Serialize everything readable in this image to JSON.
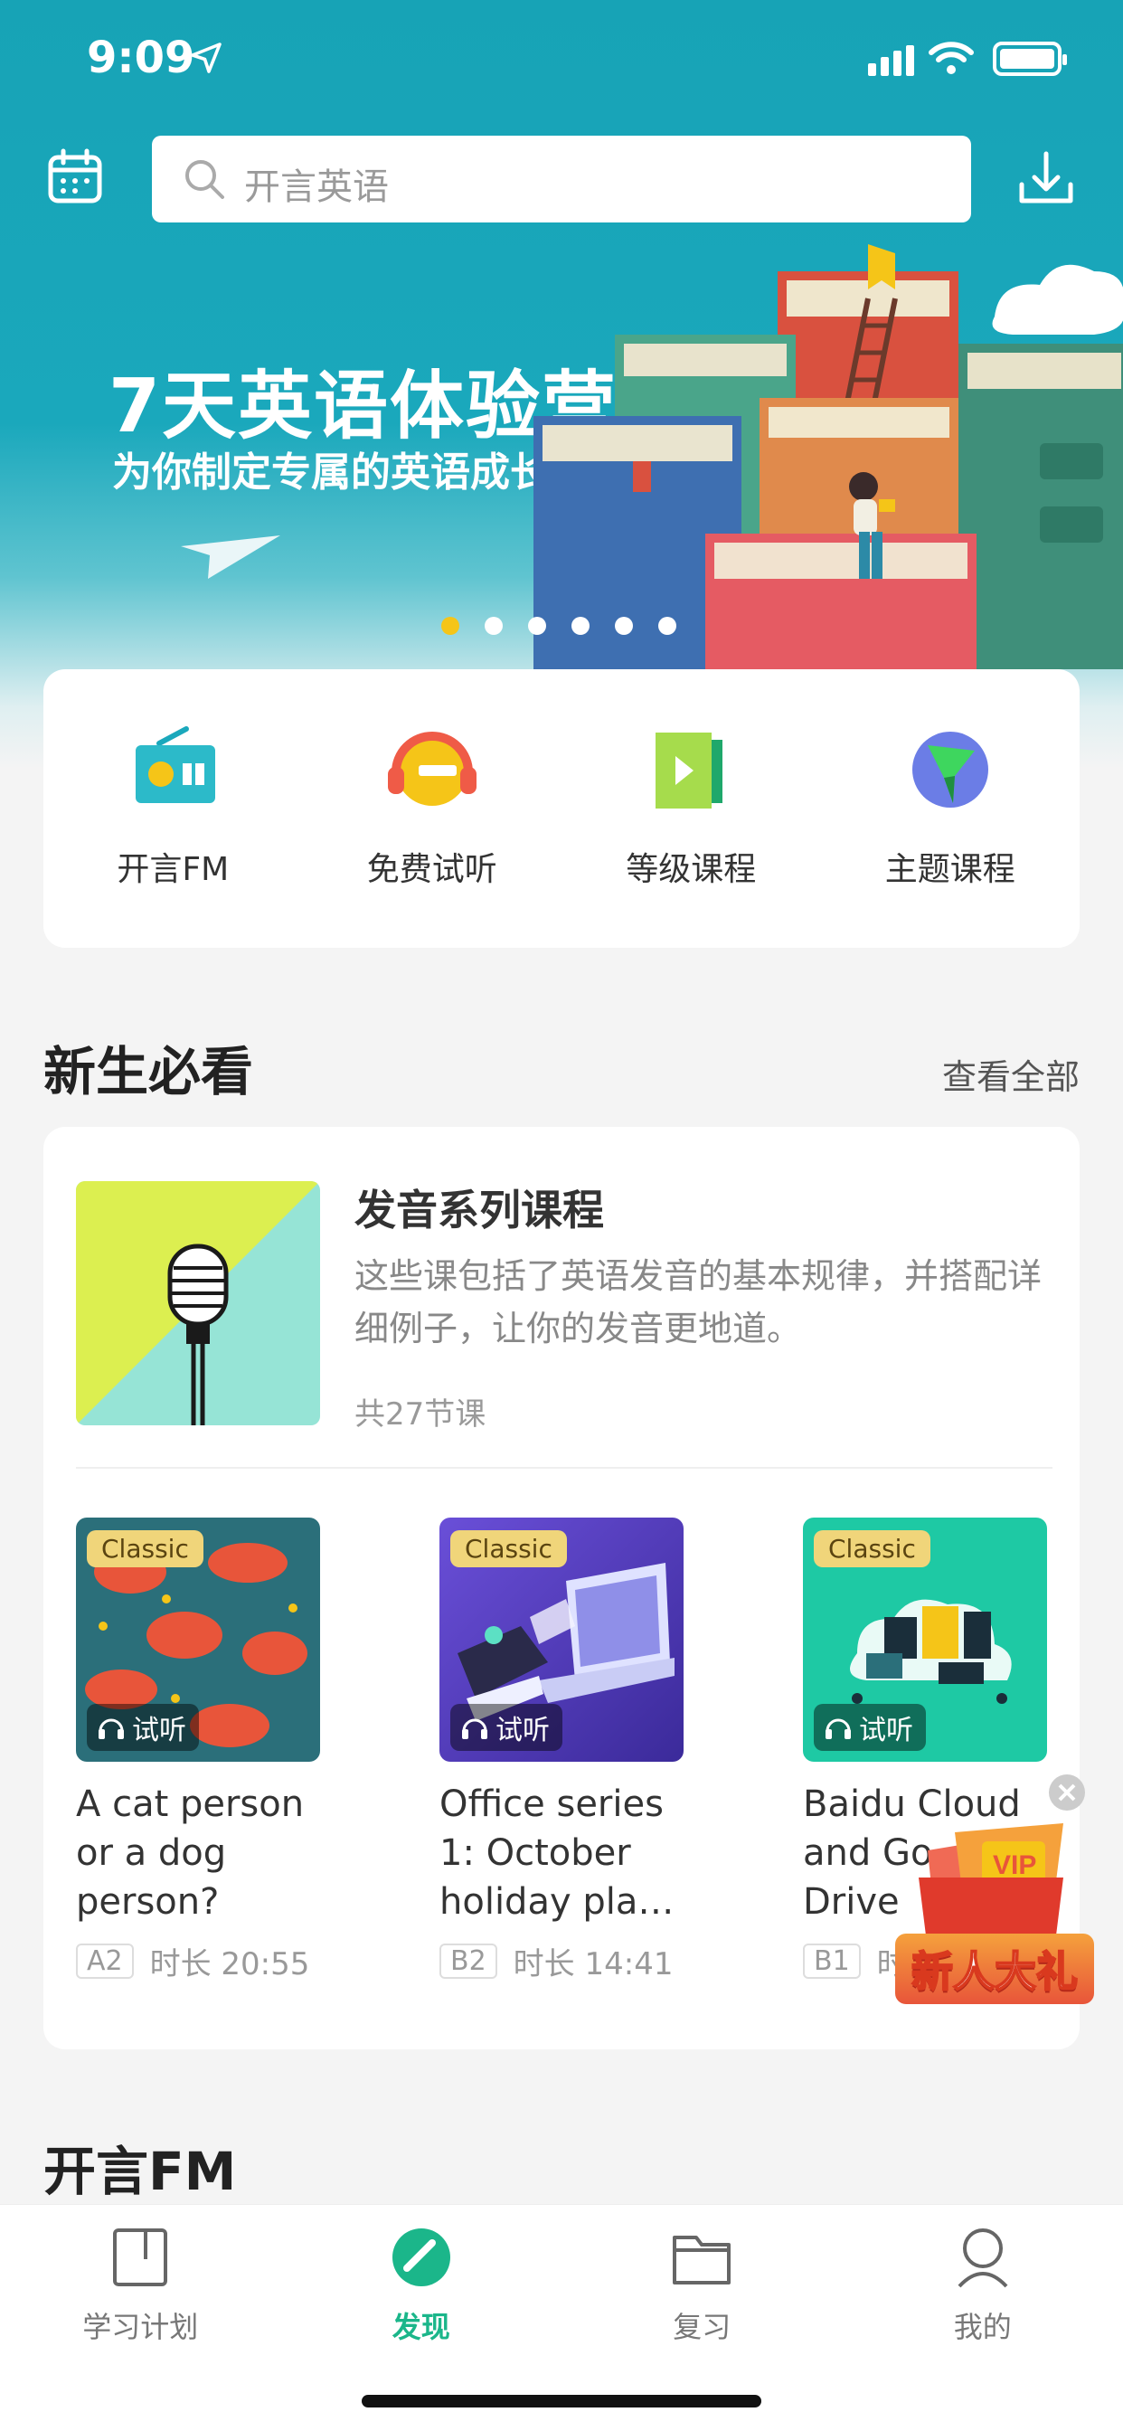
{
  "status": {
    "time": "9:09"
  },
  "search": {
    "placeholder": "开言英语"
  },
  "banner": {
    "title": "7天英语体验营",
    "subtitle": "为你制定专属的英语成长计划",
    "dots": 6,
    "active_dot": 0
  },
  "quick": [
    {
      "label": "开言FM",
      "icon": "radio-icon"
    },
    {
      "label": "免费试听",
      "icon": "headphones-icon"
    },
    {
      "label": "等级课程",
      "icon": "video-icon"
    },
    {
      "label": "主题课程",
      "icon": "globe-icon"
    }
  ],
  "section": {
    "title": "新生必看",
    "more": "查看全部"
  },
  "featured": {
    "title": "发音系列课程",
    "desc": "这些课包括了英语发音的基本规律，并搭配详细例子，让你的发音更地道。",
    "count": "共27节课"
  },
  "courses": [
    {
      "badge": "Classic",
      "trial": "试听",
      "title": "A cat person or a dog person?",
      "level": "A2",
      "duration": "时长 20:55"
    },
    {
      "badge": "Classic",
      "trial": "试听",
      "title": "Office series 1: October holiday pla…",
      "level": "B2",
      "duration": "时长 14:41"
    },
    {
      "badge": "Classic",
      "trial": "试听",
      "title": "Baidu Cloud and Go… Drive",
      "level": "B1",
      "duration": "时长"
    }
  ],
  "promo": {
    "label": "新人大礼",
    "vip": "VIP"
  },
  "fm_section": {
    "title": "开言FM"
  },
  "tabs": [
    {
      "label": "学习计划",
      "active": false
    },
    {
      "label": "发现",
      "active": true
    },
    {
      "label": "复习",
      "active": false
    },
    {
      "label": "我的",
      "active": false
    }
  ],
  "colors": {
    "brand": "#1aa8bc",
    "accent": "#1bb68a",
    "dot_active": "#f5c518"
  }
}
